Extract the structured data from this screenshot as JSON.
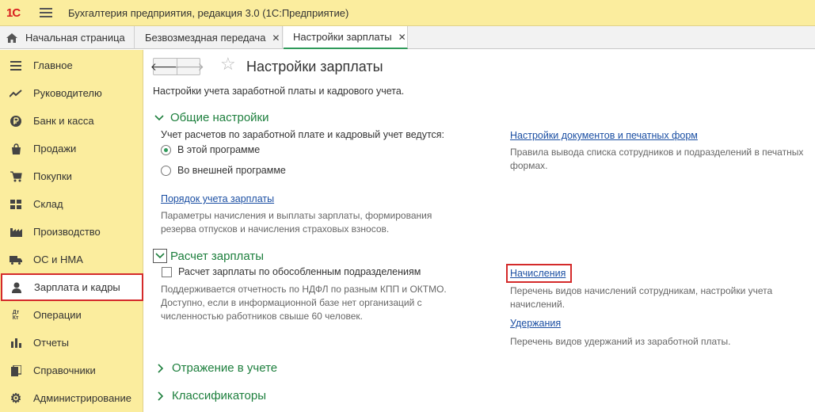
{
  "titlebar": {
    "logo": "1С",
    "title": "Бухгалтерия предприятия, редакция 3.0  (1С:Предприятие)"
  },
  "tabs": [
    {
      "label": "Начальная страница"
    },
    {
      "label": "Безвозмездная передача",
      "close": "✕"
    },
    {
      "label": "Настройки зарплаты",
      "close": "✕"
    }
  ],
  "sidebar": {
    "items": [
      {
        "label": "Главное",
        "icon": "menu-lines-icon"
      },
      {
        "label": "Руководителю",
        "icon": "trend-icon"
      },
      {
        "label": "Банк и касса",
        "icon": "ruble-coin-icon"
      },
      {
        "label": "Продажи",
        "icon": "shopping-bag-icon"
      },
      {
        "label": "Покупки",
        "icon": "cart-icon"
      },
      {
        "label": "Склад",
        "icon": "grid-icon"
      },
      {
        "label": "Производство",
        "icon": "factory-icon"
      },
      {
        "label": "ОС и НМА",
        "icon": "truck-icon"
      },
      {
        "label": "Зарплата и кадры",
        "icon": "person-icon"
      },
      {
        "label": "Операции",
        "icon": "dt-kt-icon"
      },
      {
        "label": "Отчеты",
        "icon": "bar-chart-icon"
      },
      {
        "label": "Справочники",
        "icon": "books-icon"
      },
      {
        "label": "Администрирование",
        "icon": "gear-icon"
      }
    ],
    "dtkt_glyph": "Дт\nКт"
  },
  "main": {
    "title": "Настройки зарплаты",
    "description": "Настройки учета заработной платы и кадрового учета.",
    "general": {
      "heading": "Общие настройки",
      "question": "Учет расчетов по заработной плате и кадровый учет ведутся:",
      "option1": "В этой программе",
      "option2": "Во внешней программе",
      "link_order": "Порядок учета зарплаты",
      "order_desc": "Параметры начисления и выплаты зарплаты, формирования резерва отпусков и начисления страховых взносов.",
      "link_docs": "Настройки документов и печатных форм",
      "docs_desc": "Правила вывода списка сотрудников и подразделений в печатных формах."
    },
    "payroll": {
      "heading": "Расчет зарплаты",
      "checkbox": "Расчет зарплаты по обособленным подразделениям",
      "checkbox_desc": "Поддерживается отчетность по НДФЛ по разным КПП и ОКТМО. Доступно, если в информационной базе нет организаций с численностью работников свыше 60 человек.",
      "link_accruals": "Начисления",
      "accruals_desc": "Перечень видов начислений сотрудникам, настройки учета начислений.",
      "link_deductions": "Удержания",
      "deductions_desc": "Перечень видов удержаний из заработной платы."
    },
    "reflect": {
      "heading": "Отражение в учете"
    },
    "classifiers": {
      "heading": "Классификаторы"
    }
  }
}
